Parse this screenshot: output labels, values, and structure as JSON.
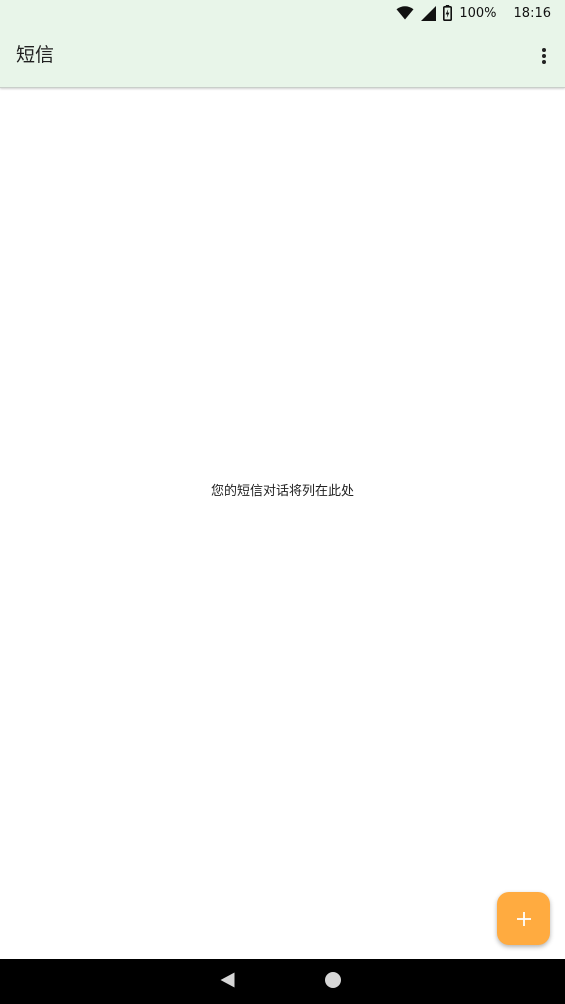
{
  "status_bar": {
    "battery_percent": "100%",
    "time": "18:16",
    "icons": [
      "wifi-icon",
      "signal-icon",
      "battery-icon"
    ]
  },
  "app_bar": {
    "title": "短信",
    "menu_icon": "more-vert-icon"
  },
  "main": {
    "empty_message": "您的短信对话将列在此处"
  },
  "fab": {
    "icon": "plus-icon",
    "color": "#ffab40"
  },
  "nav_bar": {
    "icons": [
      "back-icon",
      "home-icon"
    ]
  },
  "colors": {
    "app_bar_bg": "#e8f5e9",
    "fab": "#ffab40",
    "nav_bar_bg": "#000000"
  }
}
